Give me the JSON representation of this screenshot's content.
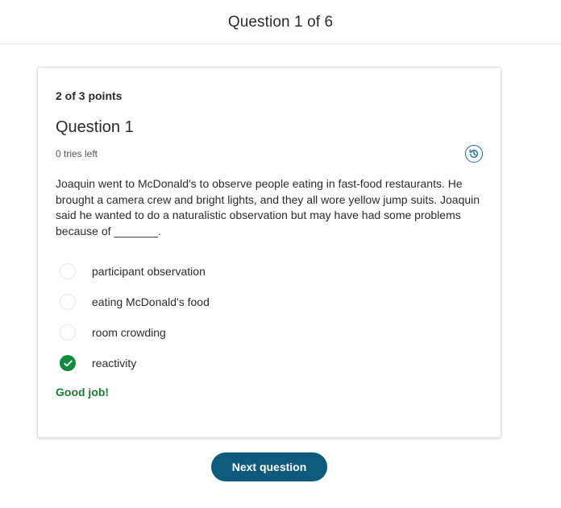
{
  "header": {
    "title": "Question 1 of 6"
  },
  "card": {
    "points": "2 of 3 points",
    "question_title": "Question 1",
    "tries_left": "0 tries left",
    "history_icon": "history-icon",
    "question_text": "Joaquin went to McDonald's to observe people eating in fast-food restaurants. He brought a camera crew and bright lights, and they all wore yellow jump suits. Joaquin said he wanted to do a naturalistic observation but may have had some problems because of _______.",
    "options": [
      {
        "label": "participant observation",
        "selected": false
      },
      {
        "label": "eating McDonald's food",
        "selected": false
      },
      {
        "label": "room crowding",
        "selected": false
      },
      {
        "label": "reactivity",
        "selected": true
      }
    ],
    "feedback": "Good job!"
  },
  "footer": {
    "next_label": "Next question"
  },
  "colors": {
    "accent": "#0d5a7d",
    "correct": "#128a3e",
    "feedback": "#1e7a34",
    "history_icon": "#1d6e8f"
  }
}
